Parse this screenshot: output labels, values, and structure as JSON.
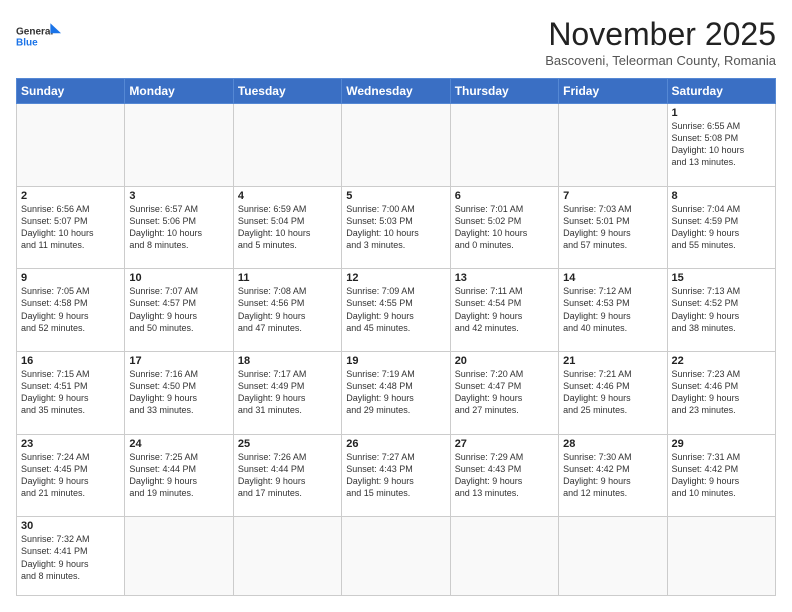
{
  "logo": {
    "text_general": "General",
    "text_blue": "Blue"
  },
  "header": {
    "month_year": "November 2025",
    "location": "Bascoveni, Teleorman County, Romania"
  },
  "weekdays": [
    "Sunday",
    "Monday",
    "Tuesday",
    "Wednesday",
    "Thursday",
    "Friday",
    "Saturday"
  ],
  "weeks": [
    [
      {
        "day": "",
        "info": ""
      },
      {
        "day": "",
        "info": ""
      },
      {
        "day": "",
        "info": ""
      },
      {
        "day": "",
        "info": ""
      },
      {
        "day": "",
        "info": ""
      },
      {
        "day": "",
        "info": ""
      },
      {
        "day": "1",
        "info": "Sunrise: 6:55 AM\nSunset: 5:08 PM\nDaylight: 10 hours\nand 13 minutes."
      }
    ],
    [
      {
        "day": "2",
        "info": "Sunrise: 6:56 AM\nSunset: 5:07 PM\nDaylight: 10 hours\nand 11 minutes."
      },
      {
        "day": "3",
        "info": "Sunrise: 6:57 AM\nSunset: 5:06 PM\nDaylight: 10 hours\nand 8 minutes."
      },
      {
        "day": "4",
        "info": "Sunrise: 6:59 AM\nSunset: 5:04 PM\nDaylight: 10 hours\nand 5 minutes."
      },
      {
        "day": "5",
        "info": "Sunrise: 7:00 AM\nSunset: 5:03 PM\nDaylight: 10 hours\nand 3 minutes."
      },
      {
        "day": "6",
        "info": "Sunrise: 7:01 AM\nSunset: 5:02 PM\nDaylight: 10 hours\nand 0 minutes."
      },
      {
        "day": "7",
        "info": "Sunrise: 7:03 AM\nSunset: 5:01 PM\nDaylight: 9 hours\nand 57 minutes."
      },
      {
        "day": "8",
        "info": "Sunrise: 7:04 AM\nSunset: 4:59 PM\nDaylight: 9 hours\nand 55 minutes."
      }
    ],
    [
      {
        "day": "9",
        "info": "Sunrise: 7:05 AM\nSunset: 4:58 PM\nDaylight: 9 hours\nand 52 minutes."
      },
      {
        "day": "10",
        "info": "Sunrise: 7:07 AM\nSunset: 4:57 PM\nDaylight: 9 hours\nand 50 minutes."
      },
      {
        "day": "11",
        "info": "Sunrise: 7:08 AM\nSunset: 4:56 PM\nDaylight: 9 hours\nand 47 minutes."
      },
      {
        "day": "12",
        "info": "Sunrise: 7:09 AM\nSunset: 4:55 PM\nDaylight: 9 hours\nand 45 minutes."
      },
      {
        "day": "13",
        "info": "Sunrise: 7:11 AM\nSunset: 4:54 PM\nDaylight: 9 hours\nand 42 minutes."
      },
      {
        "day": "14",
        "info": "Sunrise: 7:12 AM\nSunset: 4:53 PM\nDaylight: 9 hours\nand 40 minutes."
      },
      {
        "day": "15",
        "info": "Sunrise: 7:13 AM\nSunset: 4:52 PM\nDaylight: 9 hours\nand 38 minutes."
      }
    ],
    [
      {
        "day": "16",
        "info": "Sunrise: 7:15 AM\nSunset: 4:51 PM\nDaylight: 9 hours\nand 35 minutes."
      },
      {
        "day": "17",
        "info": "Sunrise: 7:16 AM\nSunset: 4:50 PM\nDaylight: 9 hours\nand 33 minutes."
      },
      {
        "day": "18",
        "info": "Sunrise: 7:17 AM\nSunset: 4:49 PM\nDaylight: 9 hours\nand 31 minutes."
      },
      {
        "day": "19",
        "info": "Sunrise: 7:19 AM\nSunset: 4:48 PM\nDaylight: 9 hours\nand 29 minutes."
      },
      {
        "day": "20",
        "info": "Sunrise: 7:20 AM\nSunset: 4:47 PM\nDaylight: 9 hours\nand 27 minutes."
      },
      {
        "day": "21",
        "info": "Sunrise: 7:21 AM\nSunset: 4:46 PM\nDaylight: 9 hours\nand 25 minutes."
      },
      {
        "day": "22",
        "info": "Sunrise: 7:23 AM\nSunset: 4:46 PM\nDaylight: 9 hours\nand 23 minutes."
      }
    ],
    [
      {
        "day": "23",
        "info": "Sunrise: 7:24 AM\nSunset: 4:45 PM\nDaylight: 9 hours\nand 21 minutes."
      },
      {
        "day": "24",
        "info": "Sunrise: 7:25 AM\nSunset: 4:44 PM\nDaylight: 9 hours\nand 19 minutes."
      },
      {
        "day": "25",
        "info": "Sunrise: 7:26 AM\nSunset: 4:44 PM\nDaylight: 9 hours\nand 17 minutes."
      },
      {
        "day": "26",
        "info": "Sunrise: 7:27 AM\nSunset: 4:43 PM\nDaylight: 9 hours\nand 15 minutes."
      },
      {
        "day": "27",
        "info": "Sunrise: 7:29 AM\nSunset: 4:43 PM\nDaylight: 9 hours\nand 13 minutes."
      },
      {
        "day": "28",
        "info": "Sunrise: 7:30 AM\nSunset: 4:42 PM\nDaylight: 9 hours\nand 12 minutes."
      },
      {
        "day": "29",
        "info": "Sunrise: 7:31 AM\nSunset: 4:42 PM\nDaylight: 9 hours\nand 10 minutes."
      }
    ],
    [
      {
        "day": "30",
        "info": "Sunrise: 7:32 AM\nSunset: 4:41 PM\nDaylight: 9 hours\nand 8 minutes."
      },
      {
        "day": "",
        "info": ""
      },
      {
        "day": "",
        "info": ""
      },
      {
        "day": "",
        "info": ""
      },
      {
        "day": "",
        "info": ""
      },
      {
        "day": "",
        "info": ""
      },
      {
        "day": "",
        "info": ""
      }
    ]
  ]
}
